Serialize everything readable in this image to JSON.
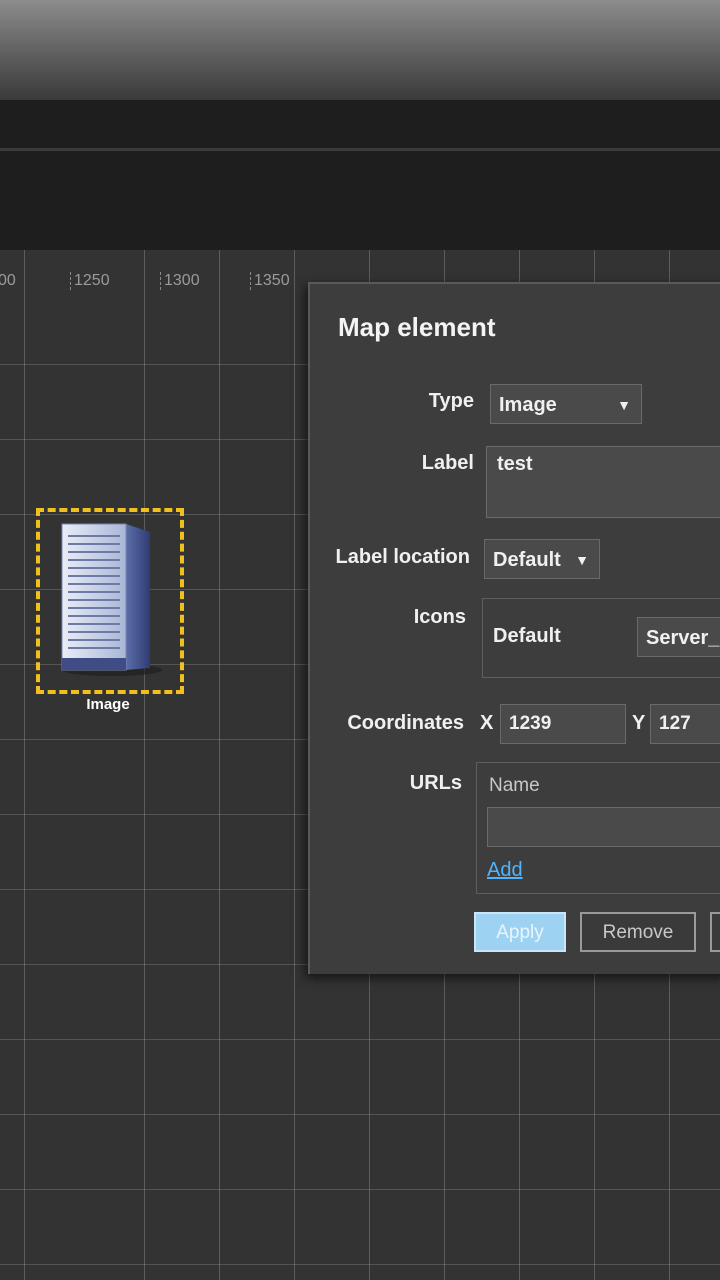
{
  "ruler": {
    "ticks": [
      "00",
      "1250",
      "1300",
      "1350"
    ]
  },
  "map_element": {
    "label": "Image",
    "icon": "server-rack-icon"
  },
  "dialog": {
    "title": "Map element",
    "type": {
      "label": "Type",
      "value": "Image"
    },
    "label_field": {
      "label": "Label",
      "value": "test"
    },
    "label_location": {
      "label": "Label location",
      "value": "Default"
    },
    "icons": {
      "label": "Icons",
      "default_label": "Default",
      "default_value": "Server_("
    },
    "coordinates": {
      "label": "Coordinates",
      "x_label": "X",
      "x_value": "1239",
      "y_label": "Y",
      "y_value": "127"
    },
    "urls": {
      "label": "URLs",
      "name_header": "Name",
      "add_link": "Add"
    },
    "buttons": {
      "apply": "Apply",
      "remove": "Remove"
    }
  },
  "colors": {
    "selection": "#f2c01e",
    "link": "#4fb4ff",
    "primary_button": "#9ed2f2"
  }
}
